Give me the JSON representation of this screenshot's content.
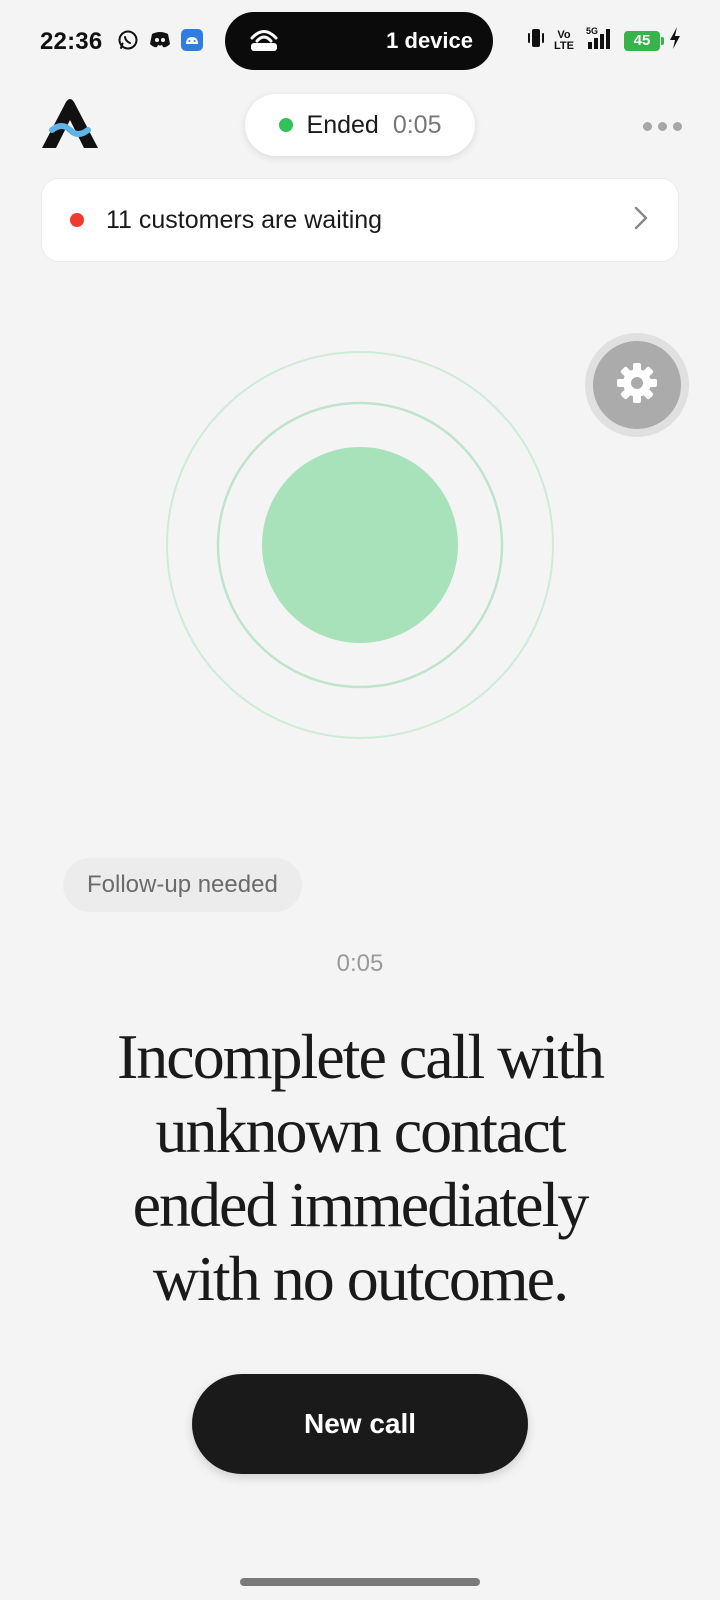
{
  "status_bar": {
    "time": "22:36",
    "app_icons": [
      "whatsapp-icon",
      "discord-icon",
      "android-app-icon"
    ],
    "island_text": "1 device",
    "network_label_top": "Vo",
    "network_label_bottom": "LTE",
    "network_type": "5G",
    "battery_level": "45"
  },
  "header": {
    "call_status": "Ended",
    "call_timer": "0:05"
  },
  "waiting_banner": {
    "text": "11 customers are waiting"
  },
  "call_summary": {
    "tag": "Follow-up needed",
    "duration": "0:05",
    "summary_text": "Incomplete call with unknown contact ended immediately with no outcome."
  },
  "actions": {
    "new_call_label": "New call"
  },
  "colors": {
    "accent_green": "#33c15a",
    "orb_fill": "#a8e2bb",
    "orb_ring": "#c9ead4",
    "alert_red": "#ef3b2d",
    "button_dark": "#1a1a1a"
  }
}
